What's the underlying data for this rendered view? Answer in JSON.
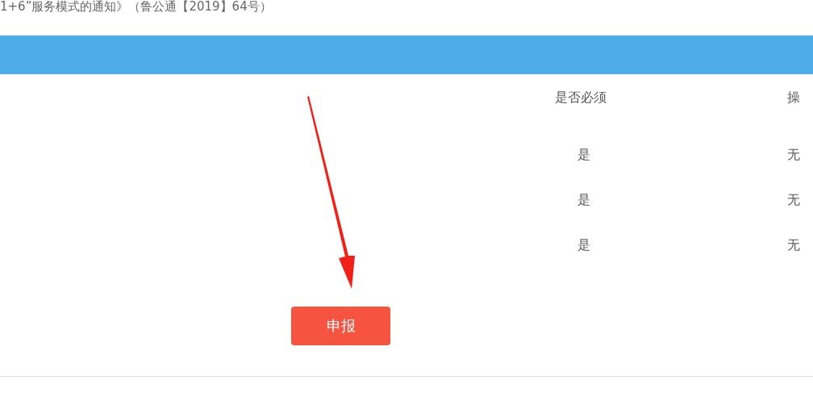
{
  "notice": "1+6”服务模式的通知》（鲁公通【2019】64号）",
  "table": {
    "columns": [
      "是否必须",
      "操"
    ],
    "rows": [
      {
        "required": "是",
        "action": "无"
      },
      {
        "required": "是",
        "action": "无"
      },
      {
        "required": "是",
        "action": "无"
      }
    ]
  },
  "submit_button": "申报"
}
